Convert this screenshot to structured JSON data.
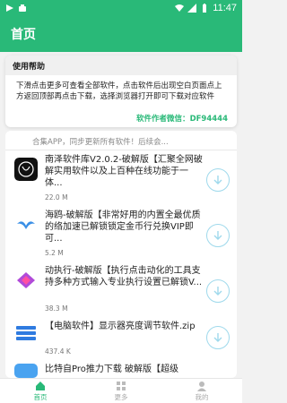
{
  "status_bar": {
    "time": "11:47"
  },
  "app_bar": {
    "title": "首页"
  },
  "notice": {
    "title": "使用帮助",
    "body": "下滑点击更多可查看全部软件，点击软件后出现空白页面点上方返回顶部再点击下载，选择浏览器打开即可下载对应软件",
    "author_label": "软件作者微信：",
    "author_id": "DF94444"
  },
  "truncated_row": {
    "text": "合集APP，同步更新所有软件！后续会..."
  },
  "apps": [
    {
      "title": "南泽软件库V2.0.2-破解版【汇聚全网破解实用软件以及上百种在线功能于一体...",
      "size": "22.0 M"
    },
    {
      "title": "海鸥-破解版【非常好用的内置全最优质的络加速已解锁锁定金币行兑换VIP即可...",
      "size": "5.2 M"
    },
    {
      "title": "动执行-破解版【执行点击动化的工具支持多种方式输入专业执行设置已解锁V...",
      "size": "38.3 M"
    },
    {
      "title": "【电脑软件】显示器亮度调节软件.zip",
      "size": "437.4 K"
    },
    {
      "title": "比特自Pro推力下载 破解版【超级",
      "size": ""
    }
  ],
  "nav": [
    {
      "label": "首页",
      "icon": "home-icon",
      "active": true
    },
    {
      "label": "更多",
      "icon": "grid-icon",
      "active": false
    },
    {
      "label": "我的",
      "icon": "user-icon",
      "active": false
    }
  ],
  "colors": {
    "primary": "#29b978",
    "download_ring": "#9fd9ec"
  }
}
